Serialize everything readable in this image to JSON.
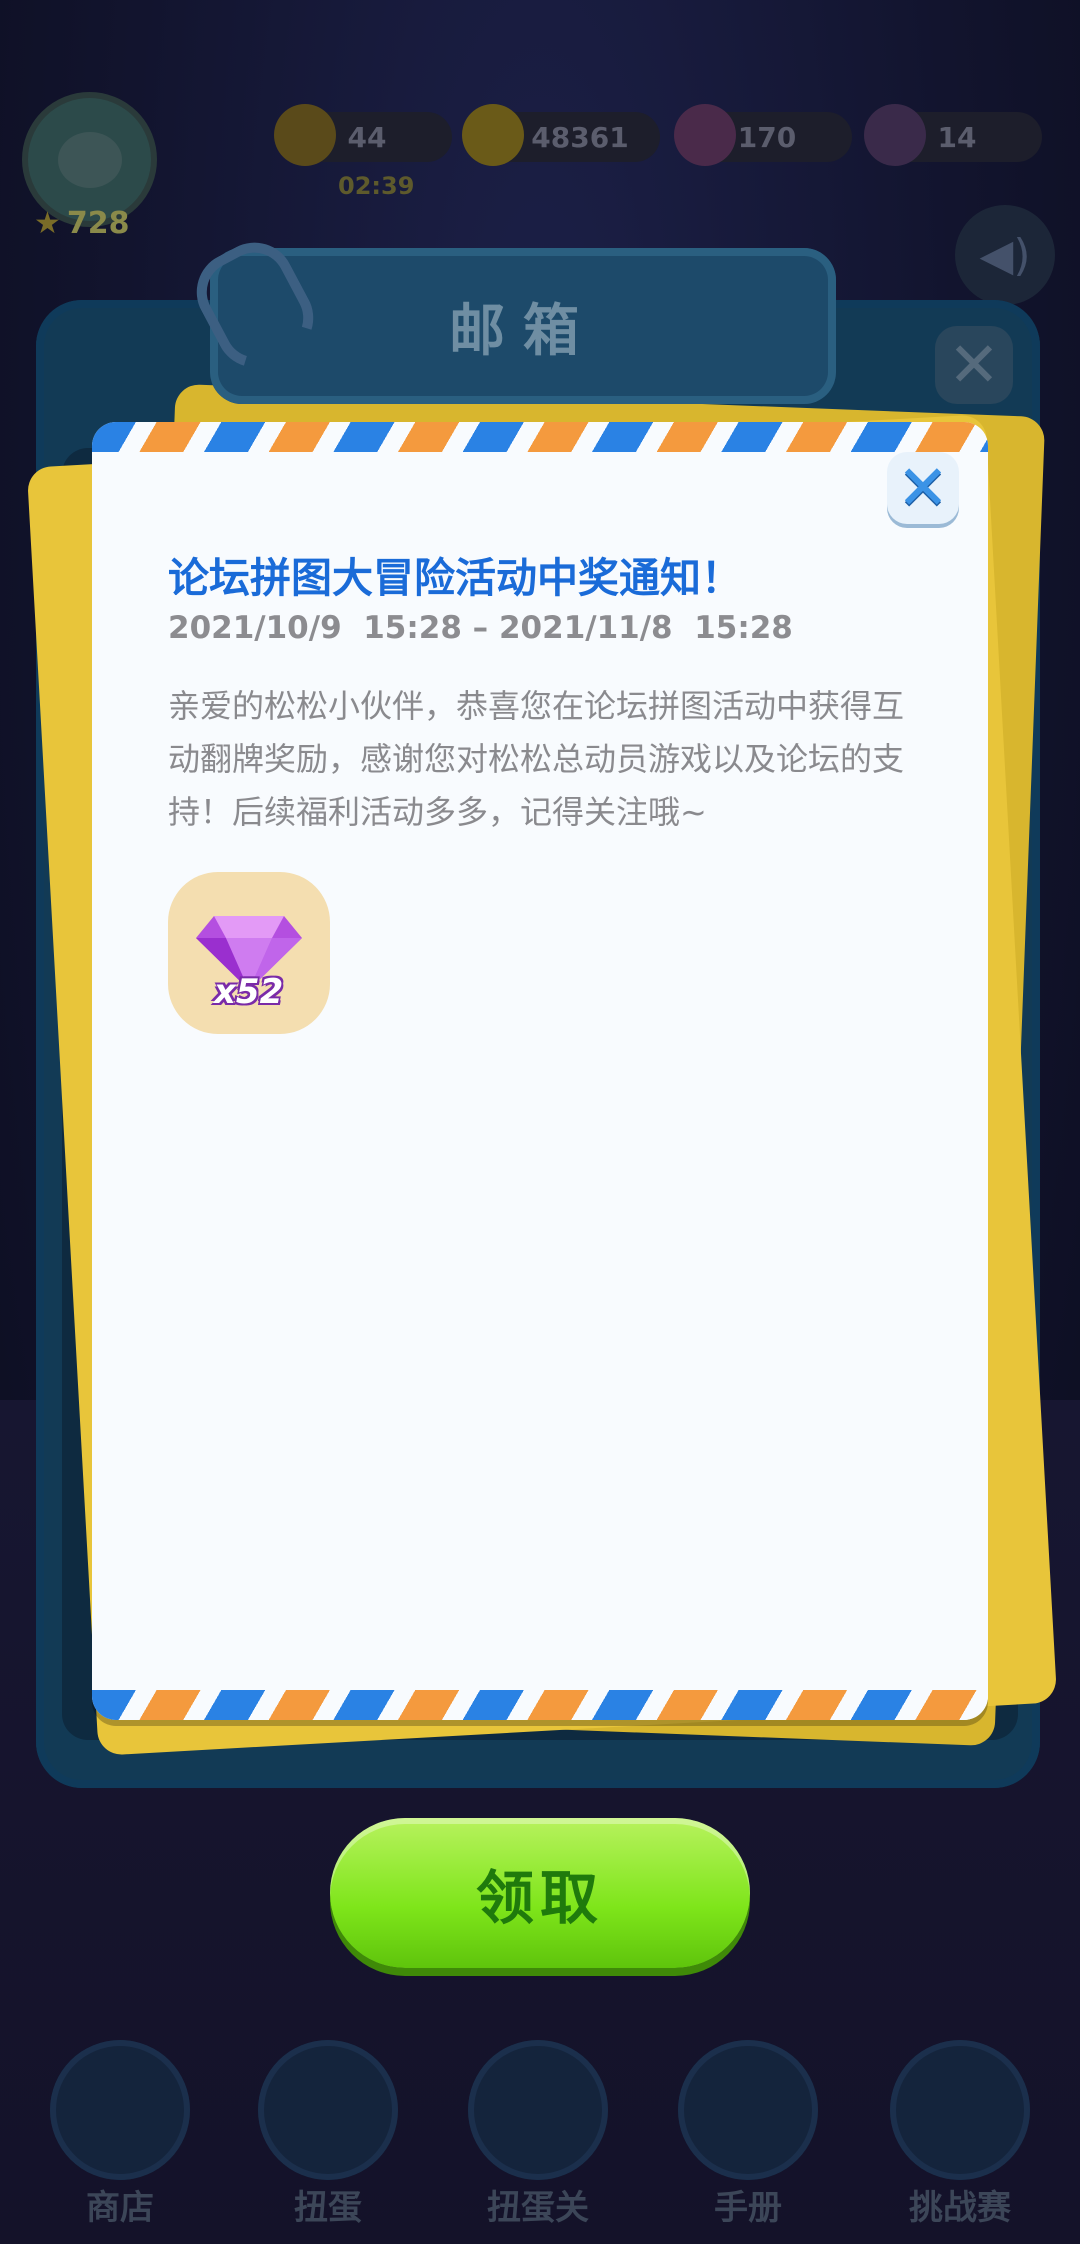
{
  "hud": {
    "level": "728",
    "energy": "44",
    "energy_timer": "02:39",
    "coins": "48361",
    "gems": "170",
    "crowns": "14"
  },
  "mailbox": {
    "title": "邮箱"
  },
  "mail": {
    "title": "论坛拼图大冒险活动中奖通知！",
    "date_range": "2021/10/9  15:28 – 2021/11/8  15:28",
    "body": "亲爱的松松小伙伴，恭喜您在论坛拼图活动中获得互动翻牌奖励，感谢您对松松总动员游戏以及论坛的支持！后续福利活动多多，记得关注哦~",
    "reward": {
      "icon": "purple-gem-icon",
      "quantity": "x52"
    }
  },
  "claim_button": {
    "label": "领取"
  },
  "bottom_nav": {
    "items": [
      {
        "label": "商店"
      },
      {
        "label": "扭蛋"
      },
      {
        "label": "扭蛋关"
      },
      {
        "label": "手册"
      },
      {
        "label": "挑战赛"
      }
    ]
  },
  "colors": {
    "accent_blue": "#1a6bd8",
    "stripe_orange": "#f49a3e",
    "stripe_blue": "#2a82e4",
    "claim_green": "#7ee51a"
  }
}
